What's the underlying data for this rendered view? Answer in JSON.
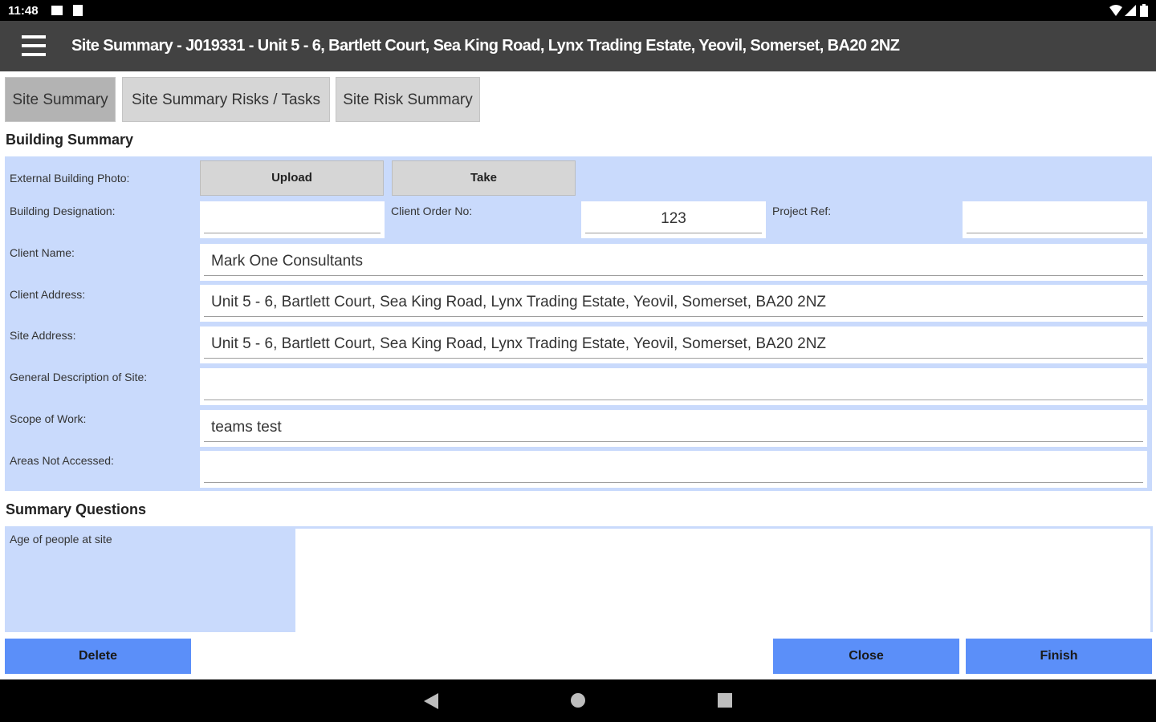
{
  "status": {
    "time": "11:48"
  },
  "header": {
    "title": "Site Summary - J019331 - Unit 5 - 6, Bartlett Court, Sea King Road, Lynx Trading Estate, Yeovil, Somerset, BA20 2NZ"
  },
  "tabs": [
    {
      "label": "Site Summary",
      "active": true
    },
    {
      "label": "Site Summary Risks / Tasks",
      "active": false
    },
    {
      "label": "Site Risk Summary",
      "active": false
    }
  ],
  "building": {
    "heading": "Building Summary",
    "photo_label": "External Building Photo:",
    "upload_label": "Upload",
    "take_label": "Take",
    "designation_label": "Building Designation:",
    "designation_value": "",
    "client_order_label": "Client Order No:",
    "client_order_value": "123",
    "project_ref_label": "Project Ref:",
    "project_ref_value": "",
    "client_name_label": "Client Name:",
    "client_name_value": "Mark One Consultants",
    "client_address_label": "Client Address:",
    "client_address_value": "Unit 5 - 6, Bartlett Court, Sea King Road, Lynx Trading Estate, Yeovil, Somerset, BA20 2NZ",
    "site_address_label": "Site Address:",
    "site_address_value": "Unit 5 - 6, Bartlett Court, Sea King Road, Lynx Trading Estate, Yeovil, Somerset, BA20 2NZ",
    "general_desc_label": "General Description of Site:",
    "general_desc_value": "",
    "scope_label": "Scope of Work:",
    "scope_value": "teams test",
    "areas_label": "Areas Not Accessed:",
    "areas_value": ""
  },
  "questions": {
    "heading": "Summary Questions",
    "q1_label": "Age of people at site",
    "q1_value": ""
  },
  "buttons": {
    "delete": "Delete",
    "close": "Close",
    "finish": "Finish"
  },
  "colors": {
    "panel": "#c9dafc",
    "action_button": "#5b8ff9",
    "app_bar": "#424242"
  }
}
